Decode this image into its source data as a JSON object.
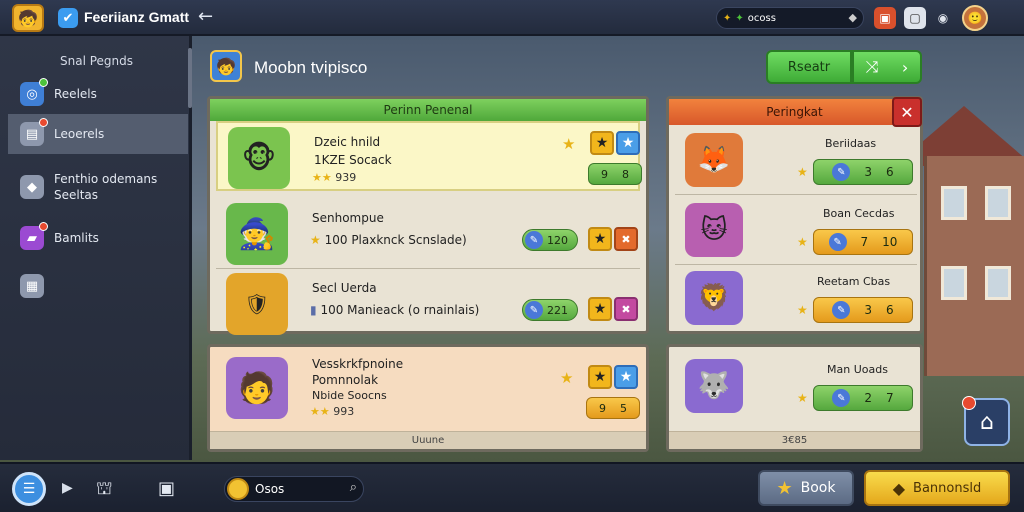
{
  "topbar": {
    "title": "Feeriianz Gmatt",
    "resource_value": "ocoss"
  },
  "sidebar": {
    "heading": "Snal Pegnds",
    "items": [
      {
        "label": "Reelels"
      },
      {
        "label": "Leoerels"
      },
      {
        "label": "Fenthio odemans Seeltas"
      },
      {
        "label": "Bamlits"
      },
      {
        "label": ""
      }
    ]
  },
  "page": {
    "title": "Moobn tvipisco",
    "reset_label": "Rseatr"
  },
  "left_panel": {
    "header": "Perinn Penenal",
    "rows": [
      {
        "name": "Dzeic hnild",
        "sub": "1KZE Socack",
        "stars_text": "939",
        "score_a": "9",
        "score_b": "8"
      },
      {
        "name": "Senhompue",
        "line": "100  Plaxknck  Scnslade)",
        "level": "120"
      },
      {
        "name": "Secl Uerda",
        "line": "100  Manieack (o rnainlais)",
        "level": "221"
      }
    ]
  },
  "left_panel2": {
    "name": "Vesskrkfpnoine",
    "sub1": "Pomnnolak",
    "sub2": "Nbide Soocns",
    "stars_text": "993",
    "score_a": "9",
    "score_b": "5",
    "footer": "Uuune"
  },
  "right_panel": {
    "header": "Peringkat",
    "rows": [
      {
        "name": "Beriidaas",
        "a": "3",
        "b": "6"
      },
      {
        "name": "Boan Cecdas",
        "a": "7",
        "b": "10"
      },
      {
        "name": "Reetam Cbas",
        "a": "3",
        "b": "6"
      }
    ]
  },
  "right_panel2": {
    "name": "Man Uoads",
    "a": "2",
    "b": "7",
    "footer": "3€85"
  },
  "bottombar": {
    "coin_value": "Osos",
    "book_label": "Book",
    "gold_label": "Bannonsld"
  },
  "colors": {
    "accent_green": "#4fa83a",
    "accent_orange": "#d8582a",
    "close_red": "#c9302c",
    "gold": "#e4a81c"
  }
}
